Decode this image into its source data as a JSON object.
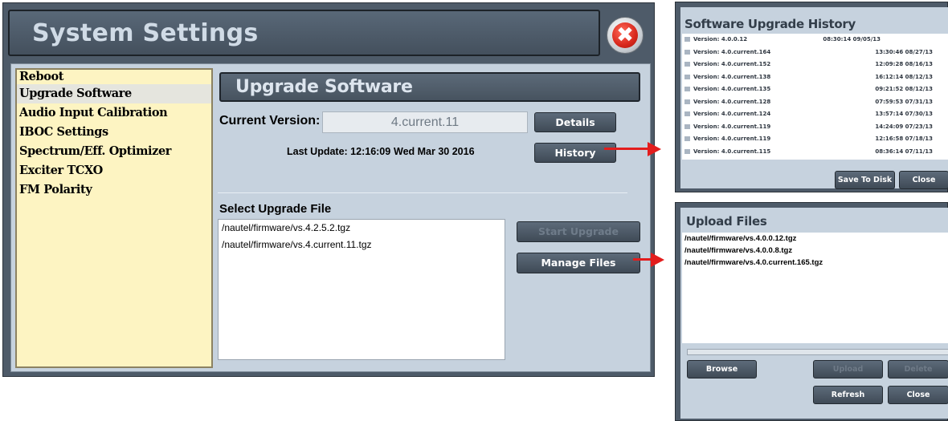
{
  "main": {
    "title": "System Settings",
    "close_symbol": "✖",
    "sidebar": {
      "items": [
        {
          "label": "Reboot"
        },
        {
          "label": "Upgrade Software"
        },
        {
          "label": "Audio Input Calibration"
        },
        {
          "label": "IBOC Settings"
        },
        {
          "label": "Spectrum/Eff. Optimizer"
        },
        {
          "label": "Exciter TCXO"
        },
        {
          "label": "FM Polarity"
        }
      ],
      "active_index": 1
    },
    "section_title": "Upgrade Software",
    "current_version_label": "Current Version:",
    "current_version_value": "4.current.11",
    "details_button": "Details",
    "last_update_label": "Last Update: 12:16:09",
    "last_update_date": "Wed Mar 30 2016",
    "history_button": "History",
    "select_file_label": "Select Upgrade File",
    "files": [
      "/nautel/firmware/vs.4.2.5.2.tgz",
      "/nautel/firmware/vs.4.current.11.tgz"
    ],
    "start_upgrade_button": "Start Upgrade",
    "manage_files_button": "Manage Files"
  },
  "history": {
    "title": "Software Upgrade History",
    "rows": [
      {
        "version": "Version: 4.0.0.12",
        "timestamp": "08:30:14 09/05/13"
      },
      {
        "version": "Version: 4.0.current.164",
        "timestamp": "13:30:46 08/27/13"
      },
      {
        "version": "Version: 4.0.current.152",
        "timestamp": "12:09:28 08/16/13"
      },
      {
        "version": "Version: 4.0.current.138",
        "timestamp": "16:12:14 08/12/13"
      },
      {
        "version": "Version: 4.0.current.135",
        "timestamp": "09:21:52 08/12/13"
      },
      {
        "version": "Version: 4.0.current.128",
        "timestamp": "07:59:53 07/31/13"
      },
      {
        "version": "Version: 4.0.current.124",
        "timestamp": "13:57:14 07/30/13"
      },
      {
        "version": "Version: 4.0.current.119",
        "timestamp": "14:24:09 07/23/13"
      },
      {
        "version": "Version: 4.0.current.119",
        "timestamp": "12:16:58 07/18/13"
      },
      {
        "version": "Version: 4.0.current.115",
        "timestamp": "08:36:14 07/11/13"
      }
    ],
    "save_button": "Save To Disk",
    "close_button": "Close"
  },
  "upload": {
    "title": "Upload Files",
    "files": [
      "/nautel/firmware/vs.4.0.0.12.tgz",
      "/nautel/firmware/vs.4.0.0.8.tgz",
      "/nautel/firmware/vs.4.0.current.165.tgz"
    ],
    "browse_button": "Browse",
    "upload_button": "Upload",
    "delete_button": "Delete",
    "refresh_button": "Refresh",
    "close_button": "Close"
  },
  "colors": {
    "window_frame": "#4e5b69",
    "panel_bg": "#c6d2de",
    "sidebar_bg": "#fdf4c2",
    "arrow": "#e31d1d",
    "close_red": "#d8281c"
  }
}
